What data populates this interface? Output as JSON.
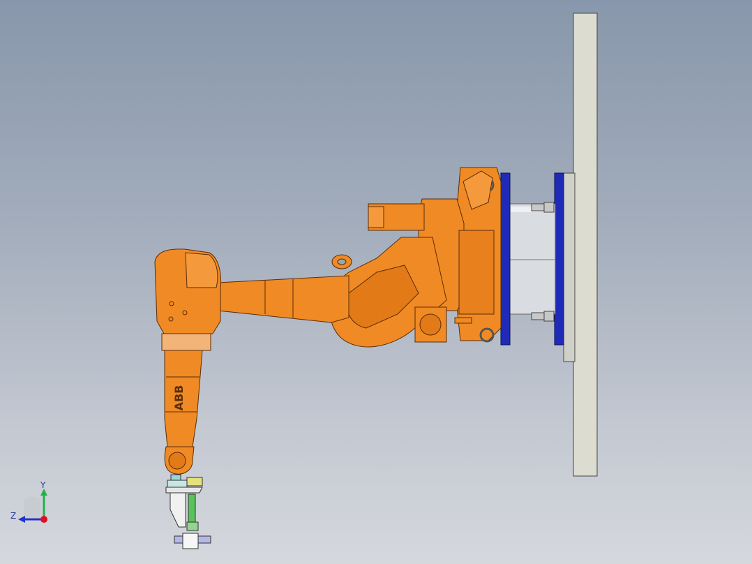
{
  "viewport": {
    "background_top": "#8897ab",
    "background_bottom": "#d5d8dd"
  },
  "robot": {
    "brand_label": "ABB",
    "body_color": "#f08a24",
    "body_shade": "#c8681a",
    "flange_color": "#1f2bb8",
    "plate_color": "#dcdcd0",
    "pedestal_color": "#d9dde2"
  },
  "triad": {
    "y_label": "Y",
    "z_label": "Z",
    "y_color": "#22b14c",
    "z_color": "#2233cc",
    "origin_color": "#e01020"
  }
}
